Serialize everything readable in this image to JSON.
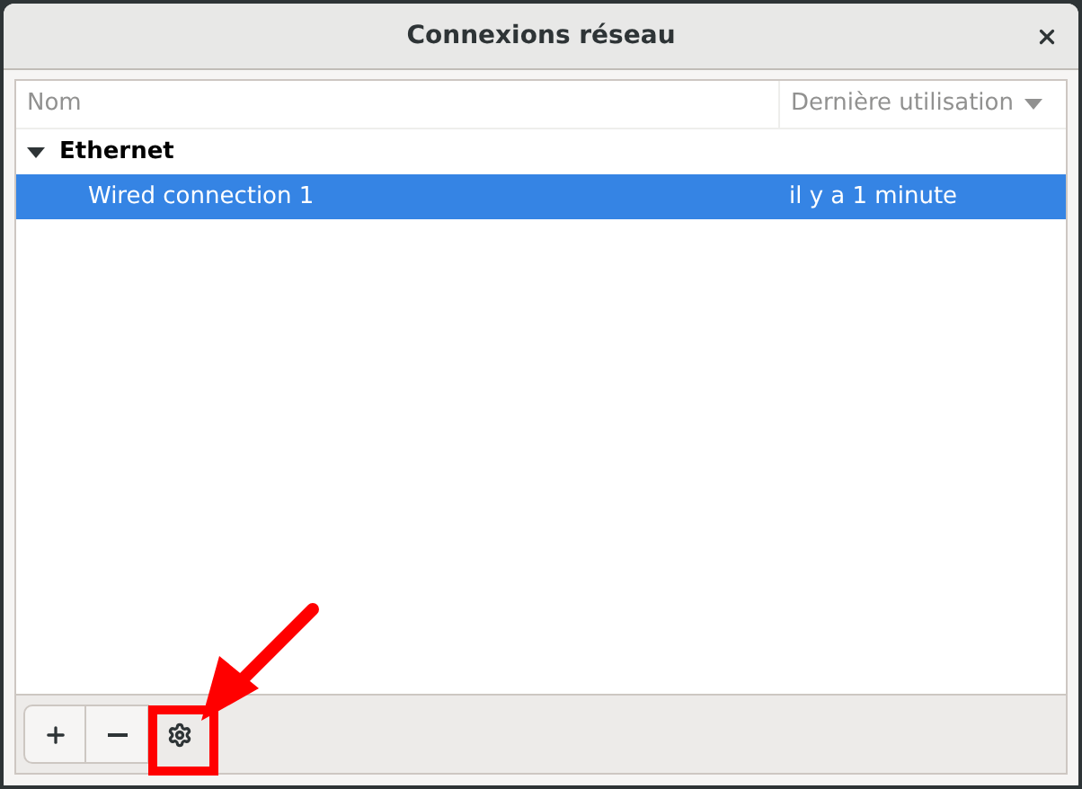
{
  "window": {
    "title": "Connexions réseau"
  },
  "table": {
    "columns": [
      {
        "label": "Nom",
        "sorted": false
      },
      {
        "label": "Dernière utilisation",
        "sorted": true
      }
    ],
    "groups": [
      {
        "name": "Ethernet",
        "expanded": true,
        "children": [
          {
            "name": "Wired connection 1",
            "last_used": "il y a 1 minute",
            "selected": true
          }
        ]
      }
    ]
  },
  "toolbar": [
    {
      "kind": "add",
      "highlighted": false
    },
    {
      "kind": "remove",
      "highlighted": false
    },
    {
      "kind": "settings",
      "highlighted": true
    }
  ]
}
